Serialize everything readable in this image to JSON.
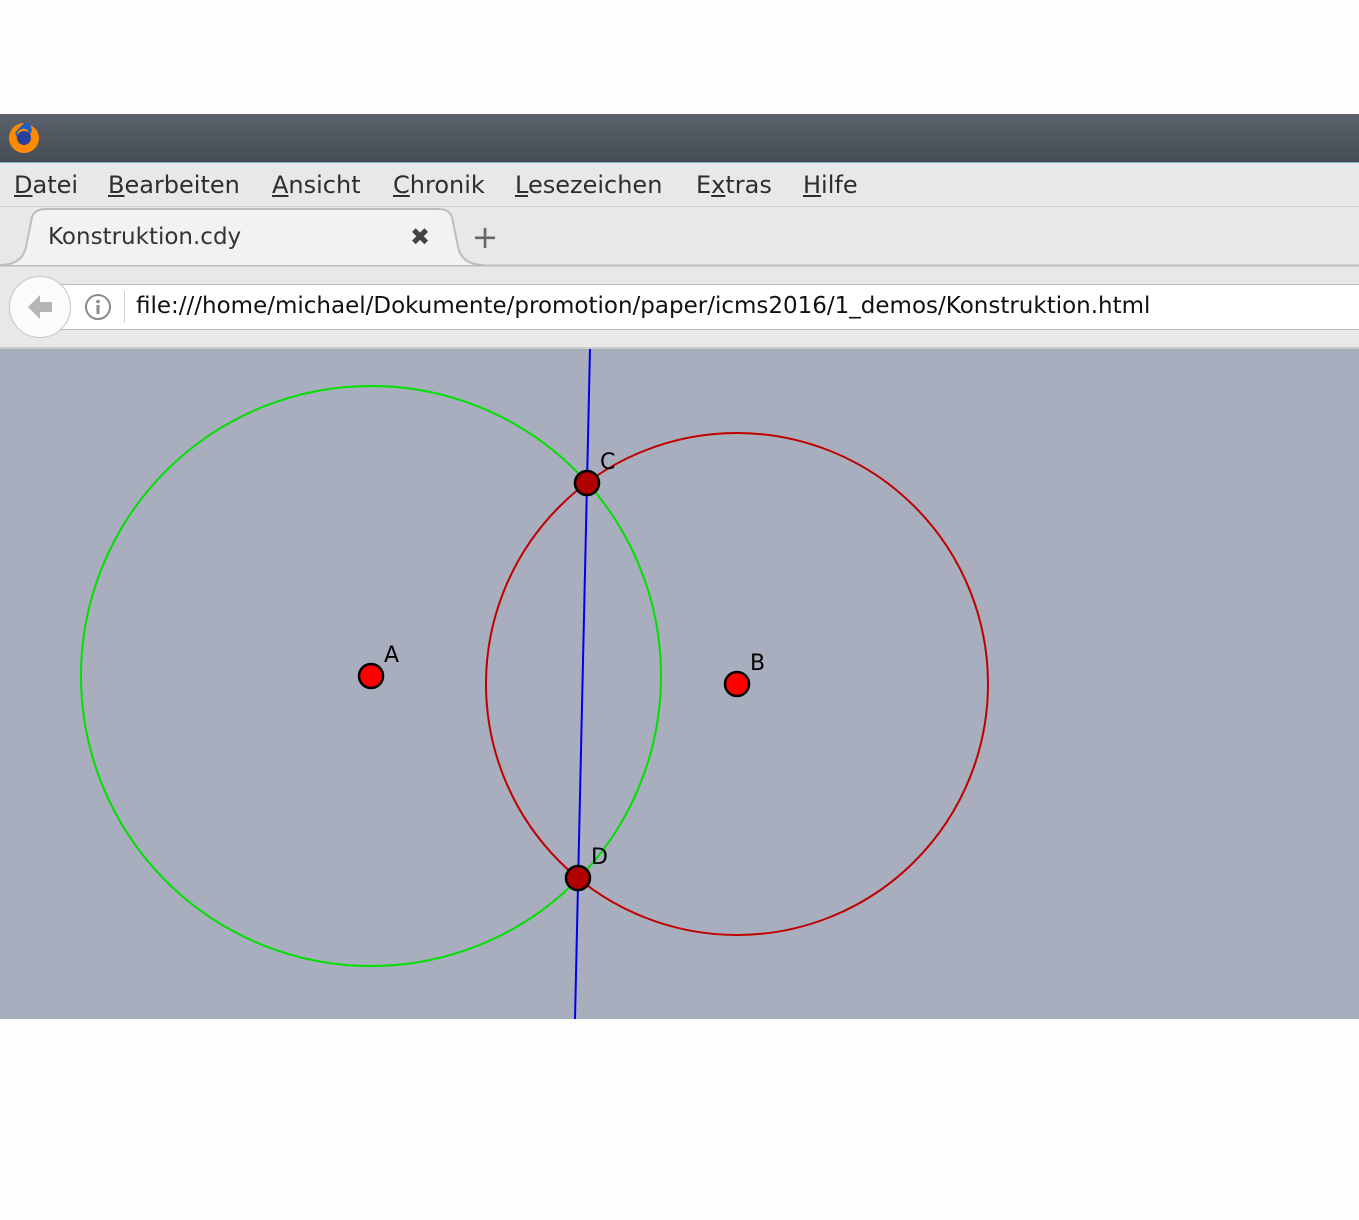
{
  "browser": {
    "menu": [
      {
        "accel": "D",
        "rest": "atei"
      },
      {
        "accel": "B",
        "rest": "earbeiten"
      },
      {
        "accel": "A",
        "rest": "nsicht"
      },
      {
        "accel": "C",
        "rest": "hronik"
      },
      {
        "accel": "L",
        "rest": "esezeichen"
      },
      {
        "pre": "E",
        "accel": "x",
        "rest": "tras"
      },
      {
        "accel": "H",
        "rest": "ilfe"
      }
    ],
    "tab": {
      "title": "Konstruktion.cdy",
      "close_glyph": "✖"
    },
    "new_tab_glyph": "+",
    "url": "file:///home/michael/Dokumente/promotion/paper/icms2016/1_demos/Konstruktion.html"
  },
  "construction": {
    "background": "#a8aebd",
    "points": [
      {
        "label": "A",
        "color": "#ff0000"
      },
      {
        "label": "B",
        "color": "#ff0000"
      },
      {
        "label": "C",
        "color": "#b00000"
      },
      {
        "label": "D",
        "color": "#b00000"
      }
    ],
    "circle_colors": {
      "circle_a": "#00e000",
      "circle_b": "#c00000"
    },
    "line_color": "#0000ee"
  }
}
